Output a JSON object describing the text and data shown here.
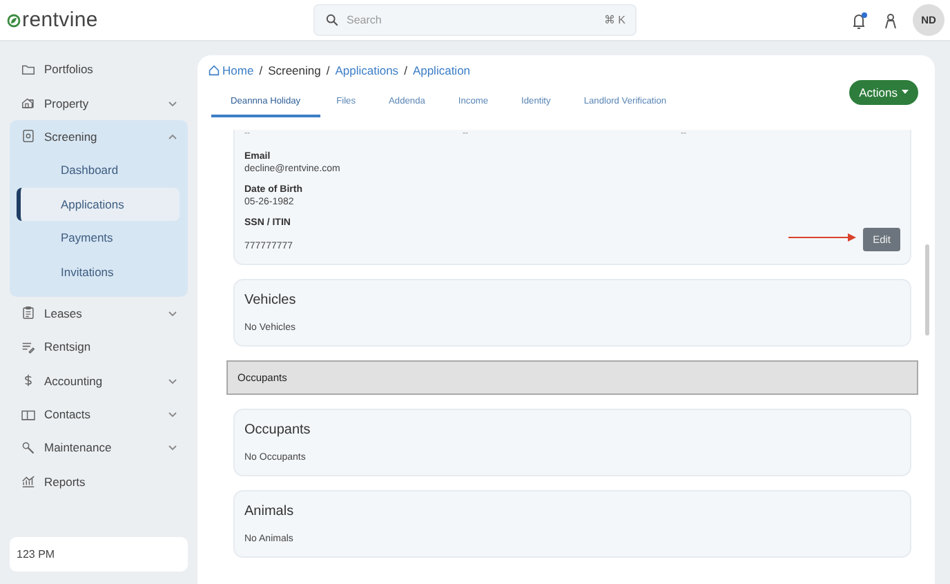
{
  "header": {
    "logo": "rentvine",
    "search": {
      "placeholder": "Search",
      "shortcut": "⌘ K"
    },
    "notifications": {
      "unread": true
    },
    "avatar": "ND"
  },
  "sidebar": {
    "items": [
      {
        "kind": "link",
        "label": "Portfolios"
      },
      {
        "kind": "group",
        "label": "Property",
        "expanded": false
      },
      {
        "kind": "group",
        "label": "Screening",
        "expanded": true,
        "children": [
          {
            "label": "Dashboard",
            "selected": false
          },
          {
            "label": "Applications",
            "selected": true
          },
          {
            "label": "Payments",
            "selected": false
          },
          {
            "label": "Invitations",
            "selected": false
          }
        ]
      },
      {
        "kind": "group",
        "label": "Leases",
        "expanded": false
      },
      {
        "kind": "link",
        "label": "Rentsign"
      },
      {
        "kind": "group",
        "label": "Accounting",
        "expanded": false
      },
      {
        "kind": "group",
        "label": "Contacts",
        "expanded": false
      },
      {
        "kind": "group",
        "label": "Maintenance",
        "expanded": false
      },
      {
        "kind": "link",
        "label": "Reports"
      }
    ],
    "footer": "123 PM"
  },
  "breadcrumb_separators": [
    "/",
    "/",
    "/"
  ],
  "breadcrumb": [
    {
      "label": "Home",
      "link": true
    },
    {
      "label": "Screening",
      "link": false
    },
    {
      "label": "Applications",
      "link": true
    },
    {
      "label": "Application",
      "link": true
    }
  ],
  "tabs": [
    {
      "label": "Deannna Holiday",
      "selected": true
    },
    {
      "label": "Files",
      "selected": false
    },
    {
      "label": "Addenda",
      "selected": false
    },
    {
      "label": "Income",
      "selected": false
    },
    {
      "label": "Identity",
      "selected": false
    },
    {
      "label": "Landlord Verification",
      "selected": false
    }
  ],
  "actions_button": "Actions",
  "applicant_card": {
    "cut_row": [
      "--",
      "--",
      "--"
    ],
    "fields": [
      {
        "label": "Email",
        "value": "decline@rentvine.com"
      },
      {
        "label": "Date of Birth",
        "value": "05-26-1982"
      },
      {
        "label": "SSN / ITIN",
        "value": "777777777"
      }
    ],
    "edit_button": "Edit"
  },
  "sections": [
    {
      "kind": "card",
      "title": "Vehicles",
      "text": "No Vehicles"
    },
    {
      "kind": "bar",
      "title": "Occupants"
    },
    {
      "kind": "card",
      "title": "Occupants",
      "text": "No Occupants"
    },
    {
      "kind": "card",
      "title": "Animals",
      "text": "No Animals"
    }
  ]
}
